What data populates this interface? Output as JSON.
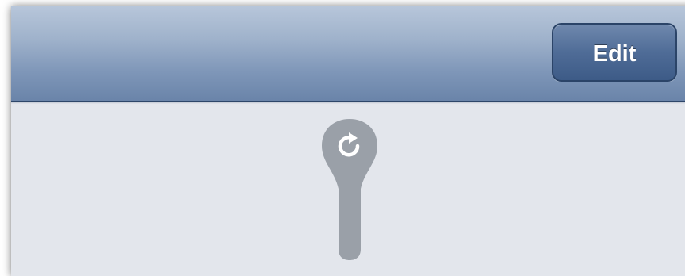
{
  "navbar": {
    "edit_label": "Edit"
  },
  "pull_to_refresh": {
    "icon": "refresh-icon"
  },
  "colors": {
    "navbar_top": "#b7c6da",
    "navbar_bottom": "#6a84a9",
    "button_fill": "#4f6c97",
    "content_background": "#e3e6ec",
    "handle_color": "#9aa0a8"
  }
}
